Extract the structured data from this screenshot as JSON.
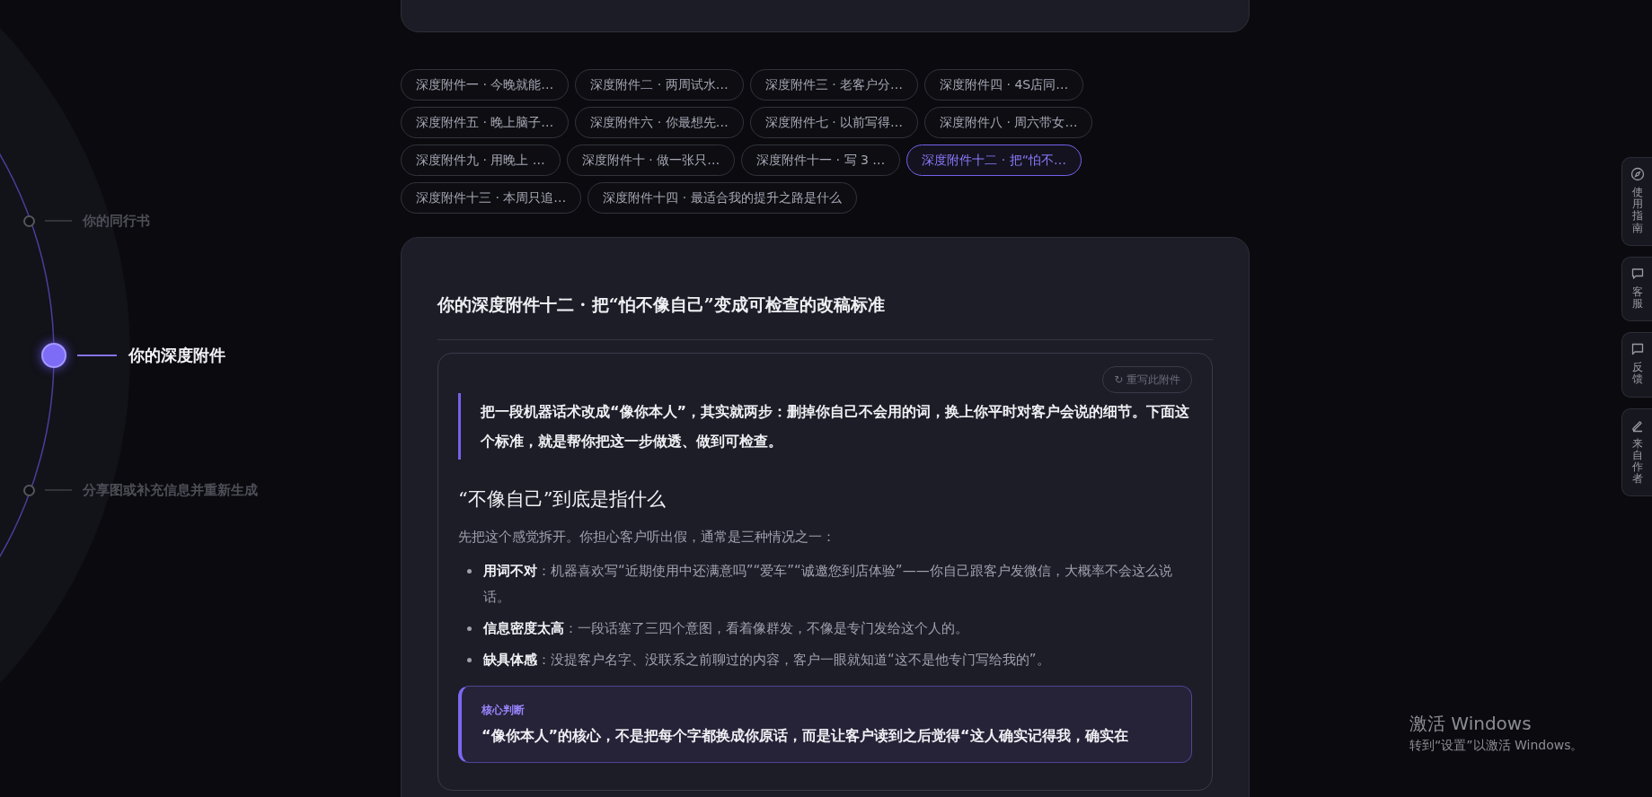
{
  "timeline": [
    {
      "label": "你的同行书",
      "selected": false
    },
    {
      "label": "你的深度附件",
      "selected": true
    },
    {
      "label": "分享图或补充信息并重新生成",
      "selected": false
    }
  ],
  "attachment_tabs": [
    {
      "label": "深度附件一 · 今晚就能…",
      "selected": false
    },
    {
      "label": "深度附件二 · 两周试水…",
      "selected": false
    },
    {
      "label": "深度附件三 · 老客户分…",
      "selected": false
    },
    {
      "label": "深度附件四 · 4S店同…",
      "selected": false
    },
    {
      "label": "深度附件五 · 晚上脑子…",
      "selected": false
    },
    {
      "label": "深度附件六 · 你最想先…",
      "selected": false
    },
    {
      "label": "深度附件七 · 以前写得…",
      "selected": false
    },
    {
      "label": "深度附件八 · 周六带女…",
      "selected": false
    },
    {
      "label": "深度附件九 · 用晚上 …",
      "selected": false
    },
    {
      "label": "深度附件十 · 做一张只…",
      "selected": false
    },
    {
      "label": "深度附件十一 · 写 3 …",
      "selected": false
    },
    {
      "label": "深度附件十二 · 把“怕不…",
      "selected": true
    },
    {
      "label": "深度附件十三 · 本周只追…",
      "selected": false
    },
    {
      "label": "深度附件十四 · 最适合我的提升之路是什么",
      "selected": false
    }
  ],
  "article": {
    "title": "你的深度附件十二 · 把“怕不像自己”变成可检查的改稿标准",
    "rewrite_button": "↻ 重写此附件",
    "lead": "把一段机器话术改成“像你本人”，其实就两步：删掉你自己不会用的词，换上你平时对客户会说的细节。下面这个标准，就是帮你把这一步做透、做到可检查。",
    "heading": "“不像自己”到底是指什么",
    "intro": "先把这个感觉拆开。你担心客户听出假，通常是三种情况之一：",
    "bullets": [
      "**用词不对**：机器喜欢写“近期使用中还满意吗”“爱车”“诚邀您到店体验”——你自己跟客户发微信，大概率不会这么说话。",
      "**信息密度太高**：一段话塞了三四个意图，看着像群发，不像是专门发给这个人的。",
      "**缺具体感**：没提客户名字、没联系之前聊过的内容，客户一眼就知道“这不是他专门写给我的”。"
    ],
    "callout": {
      "label": "核心判断",
      "text": "“像你本人”的核心，不是把每个字都换成你原话，而是让客户读到之后觉得“这人确实记得我，确实在"
    }
  },
  "side_tools": [
    {
      "kind": "compass",
      "label": "使用指南"
    },
    {
      "kind": "chat",
      "label": "客服"
    },
    {
      "kind": "feedback",
      "label": "反馈"
    },
    {
      "kind": "pen",
      "label": "来自作者"
    }
  ],
  "os_watermark": {
    "title": "激活 Windows",
    "subtitle": "转到“设置”以激活 Windows。"
  }
}
